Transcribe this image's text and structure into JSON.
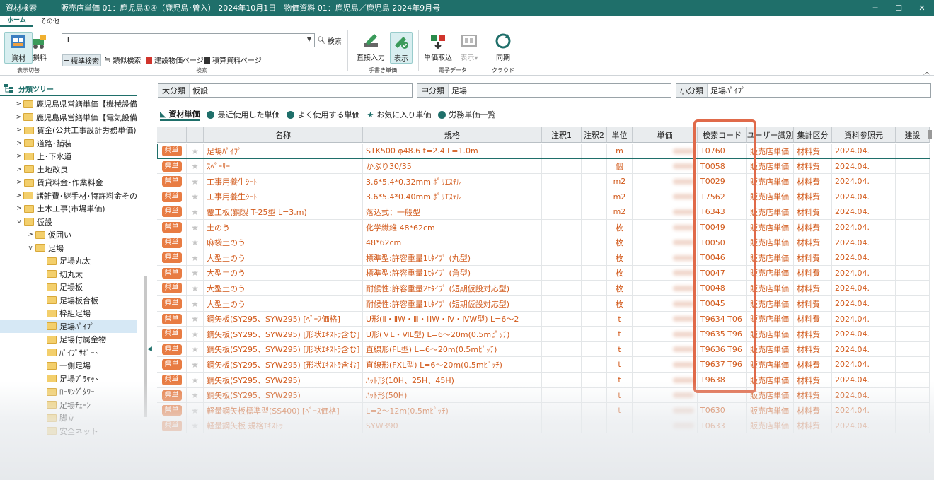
{
  "window": {
    "title": "資材検索",
    "subtitle": "販売店単価 01：鹿児島①④（鹿児島･曽入） 2024年10月1日　物価資料 01：鹿児島／鹿児島 2024年9月号",
    "min": "─",
    "max": "☐",
    "close": "✕"
  },
  "ribbon": {
    "tabs": [
      "ホーム",
      "その他"
    ],
    "display": {
      "label": "表示切替",
      "btn1": "資材",
      "btn2": "損料"
    },
    "search": {
      "label": "検索",
      "value": "T",
      "button": "検索",
      "options": [
        "標準検索",
        "類似検索",
        "建設物価ページ",
        "積算資料ページ"
      ]
    },
    "manual": {
      "label": "手書き単価",
      "btn1": "直接入力",
      "btn2": "表示"
    },
    "edata": {
      "label": "電子データ",
      "btn1": "単価取込",
      "btn2": "表示"
    },
    "cloud": {
      "label": "クラウド",
      "btn1": "同期"
    },
    "collapse": "︿"
  },
  "tree": {
    "header": "分類ツリー",
    "items": [
      {
        "label": "鹿児島県営繕単価【機械設備",
        "arrow": ">"
      },
      {
        "label": "鹿児島県営繕単価【電気設備",
        "arrow": ">"
      },
      {
        "label": "賃金(公共工事設計労務単価)",
        "arrow": ">"
      },
      {
        "label": "道路･舗装",
        "arrow": ">"
      },
      {
        "label": "上･下水道",
        "arrow": ">"
      },
      {
        "label": "土地改良",
        "arrow": ">"
      },
      {
        "label": "賃貸料金･作業料金",
        "arrow": ">"
      },
      {
        "label": "諸雑費･継手材･特許料金その",
        "arrow": ">"
      },
      {
        "label": "土木工事(市場単価)",
        "arrow": ">"
      },
      {
        "label": "仮設",
        "arrow": "v"
      },
      {
        "label": "仮囲い",
        "arrow": ">"
      },
      {
        "label": "足場",
        "arrow": "v"
      },
      {
        "label": "足場丸太",
        "arrow": ""
      },
      {
        "label": "切丸太",
        "arrow": ""
      },
      {
        "label": "足場板",
        "arrow": ""
      },
      {
        "label": "足場板合板",
        "arrow": ""
      },
      {
        "label": "枠組足場",
        "arrow": ""
      },
      {
        "label": "足場ﾊﾟｲﾌﾟ",
        "arrow": ""
      },
      {
        "label": "足場付属金物",
        "arrow": ""
      },
      {
        "label": "ﾊﾟｲﾌﾟｻﾎﾟｰﾄ",
        "arrow": ""
      },
      {
        "label": "一側足場",
        "arrow": ""
      },
      {
        "label": "足場ﾌﾞﾗｹｯﾄ",
        "arrow": ""
      },
      {
        "label": "ﾛｰﾘﾝｸﾞﾀﾜｰ",
        "arrow": ""
      },
      {
        "label": "足場ﾁｪｰﾝ",
        "arrow": ""
      },
      {
        "label": "脚立",
        "arrow": ""
      },
      {
        "label": "安全ネット",
        "arrow": ""
      }
    ]
  },
  "filters": {
    "large_label": "大分類",
    "large": "仮設",
    "mid_label": "中分類",
    "mid": "足場",
    "small_label": "小分類",
    "small": "足場ﾊﾟｲﾌﾟ"
  },
  "main_tabs": [
    "資材単価",
    "最近使用した単価",
    "よく使用する単価",
    "お気に入り単価",
    "労務単価一覧"
  ],
  "grid": {
    "headers": [
      "",
      "",
      "名称",
      "規格",
      "注釈1",
      "注釈2",
      "単位",
      "単価",
      "検索コード",
      "ユーザー識別",
      "集計区分",
      "資料参照元",
      "建設"
    ],
    "rows": [
      {
        "badge": "県単",
        "name": "足場ﾊﾟｲﾌﾟ",
        "spec": "STK500 φ48.6 t=2.4 L=1.0m",
        "unit": "m",
        "code": "T0760",
        "user": "販売店単価",
        "agg": "材料費",
        "ref": "2024.04."
      },
      {
        "badge": "県単",
        "name": "ｽﾍﾟｰｻｰ",
        "spec": "かぶり30/35",
        "unit": "個",
        "code": "T0058",
        "user": "販売店単価",
        "agg": "材料費",
        "ref": "2024.04."
      },
      {
        "badge": "県単",
        "name": "工事用養生ｼｰﾄ",
        "spec": "3.6*5.4*0.32mm ﾎﾟﾘｴｽﾃﾙ",
        "unit": "m2",
        "code": "T0029",
        "user": "販売店単価",
        "agg": "材料費",
        "ref": "2024.04."
      },
      {
        "badge": "県単",
        "name": "工事用養生ｼｰﾄ",
        "spec": "3.6*5.4*0.40mm ﾎﾟﾘｴｽﾃﾙ",
        "unit": "m2",
        "code": "T7562",
        "user": "販売店単価",
        "agg": "材料費",
        "ref": "2024.04."
      },
      {
        "badge": "県単",
        "name": "覆工板(鋼製 T-25型 L=3.m)",
        "spec": "落込式：一般型",
        "unit": "m2",
        "code": "T6343",
        "user": "販売店単価",
        "agg": "材料費",
        "ref": "2024.04."
      },
      {
        "badge": "県単",
        "name": "土のう",
        "spec": "化学繊維 48*62cm",
        "unit": "枚",
        "code": "T0049",
        "user": "販売店単価",
        "agg": "材料費",
        "ref": "2024.04."
      },
      {
        "badge": "県単",
        "name": "麻袋土のう",
        "spec": "48*62cm",
        "unit": "枚",
        "code": "T0050",
        "user": "販売店単価",
        "agg": "材料費",
        "ref": "2024.04."
      },
      {
        "badge": "県単",
        "name": "大型土のう",
        "spec": "標準型:許容重量1tﾀｲﾌﾟ (丸型)",
        "unit": "枚",
        "code": "T0046",
        "user": "販売店単価",
        "agg": "材料費",
        "ref": "2024.04."
      },
      {
        "badge": "県単",
        "name": "大型土のう",
        "spec": "標準型:許容重量1tﾀｲﾌﾟ (角型)",
        "unit": "枚",
        "code": "T0047",
        "user": "販売店単価",
        "agg": "材料費",
        "ref": "2024.04."
      },
      {
        "badge": "県単",
        "name": "大型土のう",
        "spec": "耐候性:許容重量2tﾀｲﾌﾟ (短期仮設対応型)",
        "unit": "枚",
        "code": "T0048",
        "user": "販売店単価",
        "agg": "材料費",
        "ref": "2024.04."
      },
      {
        "badge": "県単",
        "name": "大型土のう",
        "spec": "耐候性:許容重量1tﾀｲﾌﾟ (短期仮設対応型)",
        "unit": "枚",
        "code": "T0045",
        "user": "販売店単価",
        "agg": "材料費",
        "ref": "2024.04."
      },
      {
        "badge": "県単",
        "name": "鋼矢板(SY295、SYW295) [ﾍﾞｰｽ価格]",
        "spec": "U形(Ⅱ・ⅡW・Ⅲ・ⅢW・Ⅳ・ⅣW型) L=6～2",
        "unit": "t",
        "code": "T9634 T06",
        "user": "販売店単価",
        "agg": "材料費",
        "ref": "2024.04."
      },
      {
        "badge": "県単",
        "name": "鋼矢板(SY295、SYW295) [形状ｴｷｽﾄﾗ含む]",
        "spec": "U形(ＶL・ⅥL型) L=6～20m(0.5mﾋﾟｯﾁ)",
        "unit": "t",
        "code": "T9635 T96",
        "user": "販売店単価",
        "agg": "材料費",
        "ref": "2024.04."
      },
      {
        "badge": "県単",
        "name": "鋼矢板(SY295、SYW295) [形状ｴｷｽﾄﾗ含む]",
        "spec": "直線形(FL型) L=6～20m(0.5mﾋﾟｯﾁ)",
        "unit": "t",
        "code": "T9636 T96",
        "user": "販売店単価",
        "agg": "材料費",
        "ref": "2024.04."
      },
      {
        "badge": "県単",
        "name": "鋼矢板(SY295、SYW295) [形状ｴｷｽﾄﾗ含む]",
        "spec": "直線形(FXL型) L=6～20m(0.5mﾋﾟｯﾁ)",
        "unit": "t",
        "code": "T9637 T96",
        "user": "販売店単価",
        "agg": "材料費",
        "ref": "2024.04."
      },
      {
        "badge": "県単",
        "name": "鋼矢板(SY295、SYW295)",
        "spec": "ﾊｯﾄ形(10H、25H、45H)",
        "unit": "t",
        "code": "T9638",
        "user": "販売店単価",
        "agg": "材料費",
        "ref": "2024.04."
      },
      {
        "badge": "県単",
        "name": "鋼矢板(SY295、SYW295)",
        "spec": "ﾊｯﾄ形(50H)",
        "unit": "t",
        "code": "",
        "user": "販売店単価",
        "agg": "材料費",
        "ref": "2024.04."
      },
      {
        "badge": "県単",
        "name": "軽量鋼矢板標準型(SS400) [ﾍﾞｰｽ価格]",
        "spec": "L=2～12m(0.5mﾋﾟｯﾁ)",
        "unit": "t",
        "code": "T0630",
        "user": "販売店単価",
        "agg": "材料費",
        "ref": "2024.04."
      },
      {
        "badge": "県単",
        "name": "軽量鋼矢板 規格ｴｷｽﾄﾗ",
        "spec": "SYW390",
        "unit": "",
        "code": "T0633",
        "user": "販売店単価",
        "agg": "材料費",
        "ref": "2024.04."
      }
    ]
  },
  "colors": {
    "accent": "#1f6f6a",
    "badge": "#e87c43",
    "text_orange": "#d2591a",
    "highlight": "#e06a4a"
  }
}
